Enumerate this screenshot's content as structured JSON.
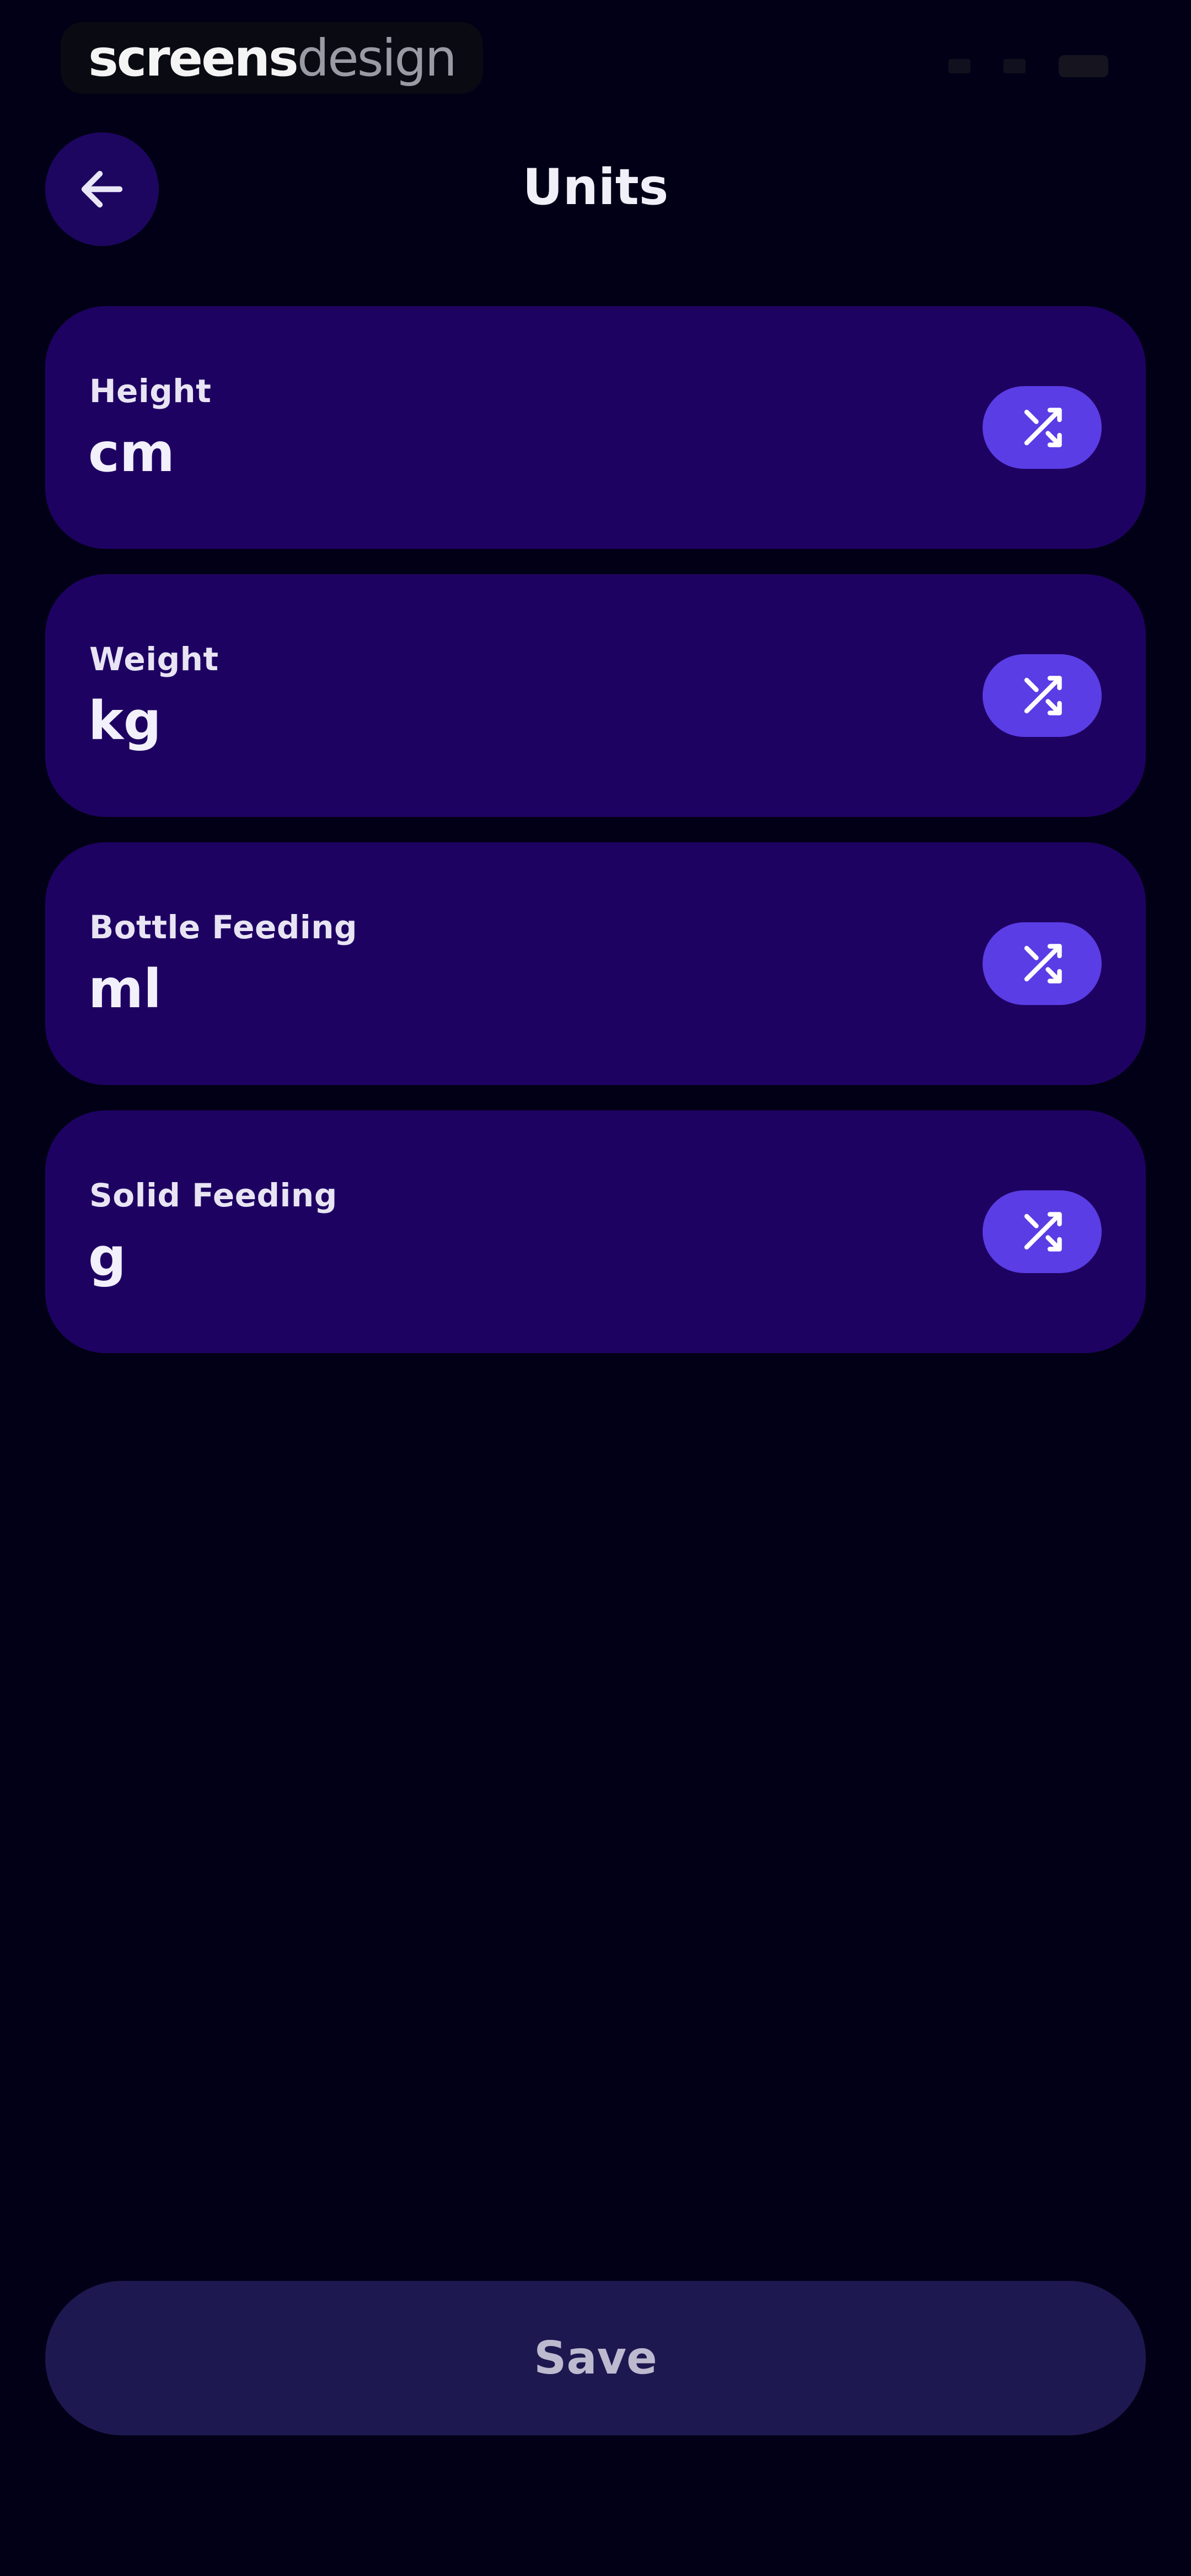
{
  "status_bar": {
    "brand_part1": "screens",
    "brand_part2": "design"
  },
  "header": {
    "title": "Units",
    "back_icon": "arrow-left-icon"
  },
  "units": [
    {
      "label": "Height",
      "value": "cm"
    },
    {
      "label": "Weight",
      "value": "kg"
    },
    {
      "label": "Bottle Feeding",
      "value": "ml"
    },
    {
      "label": "Solid Feeding",
      "value": "g"
    }
  ],
  "swap_icon": "swap-arrows-icon",
  "save_label": "Save",
  "colors": {
    "background": "#020016",
    "card": "#1e0262",
    "accent": "#5a3de4",
    "save_button": "#1e1850"
  }
}
